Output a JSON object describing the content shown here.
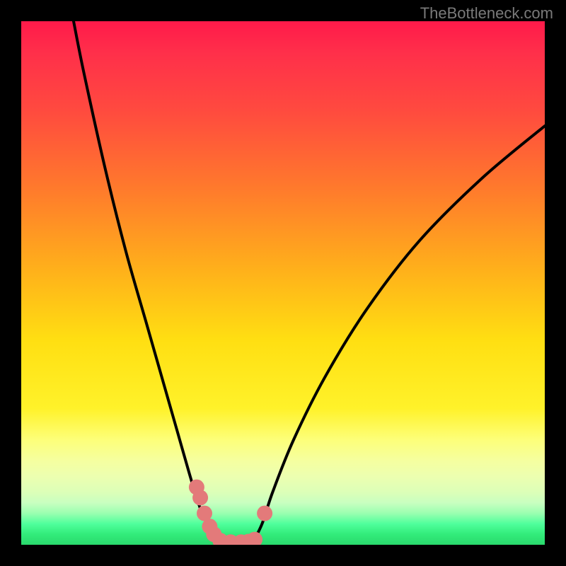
{
  "watermark": "TheBottleneck.com",
  "chart_data": {
    "type": "line",
    "title": "",
    "xlabel": "",
    "ylabel": "",
    "xlim": [
      0,
      100
    ],
    "ylim": [
      0,
      100
    ],
    "series": [
      {
        "name": "left-curve",
        "x": [
          10,
          12,
          16,
          20,
          24,
          28,
          30,
          32,
          33.5,
          35,
          37,
          39
        ],
        "y": [
          100,
          90,
          72,
          56,
          42,
          28,
          21,
          14,
          9,
          5,
          2,
          0
        ]
      },
      {
        "name": "right-curve",
        "x": [
          44,
          46,
          48,
          52,
          58,
          66,
          76,
          88,
          100
        ],
        "y": [
          0,
          4,
          10,
          20,
          32,
          45,
          58,
          70,
          80
        ]
      }
    ],
    "markers": [
      {
        "name": "left-dots",
        "x": [
          33.5,
          34.2,
          35,
          36,
          36.8
        ],
        "y": [
          11,
          9,
          6,
          3.5,
          2
        ]
      },
      {
        "name": "bottom-dots",
        "x": [
          38,
          40,
          42,
          43.4,
          44.6
        ],
        "y": [
          0.8,
          0.5,
          0.5,
          0.6,
          1
        ]
      },
      {
        "name": "right-dot",
        "x": [
          46.5
        ],
        "y": [
          6
        ]
      }
    ],
    "background_gradient": {
      "top": "#ff1a4a",
      "mid": "#fff22a",
      "bottom": "#2ad96d"
    }
  }
}
